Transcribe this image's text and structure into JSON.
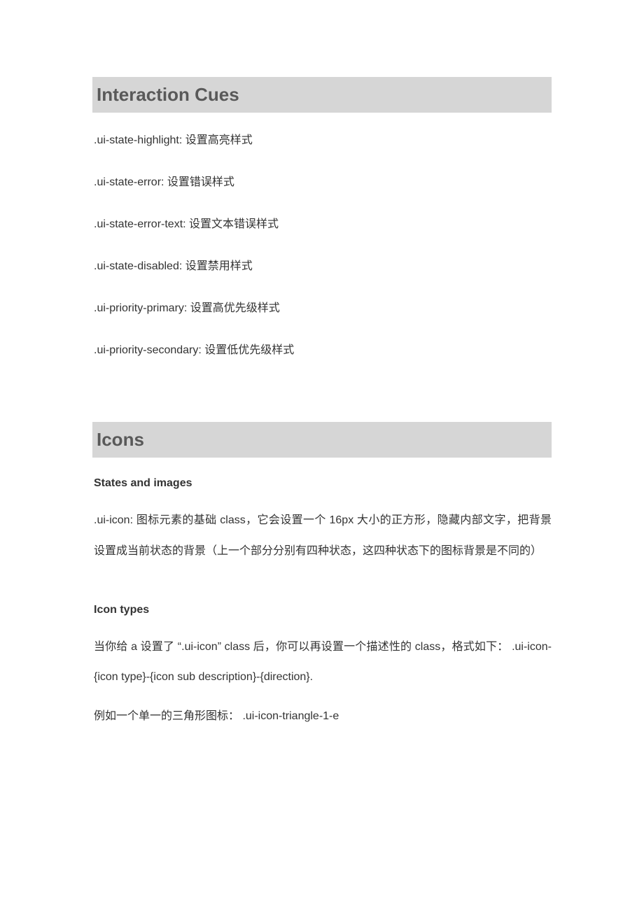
{
  "sections": {
    "interaction_cues": {
      "title": "Interaction Cues",
      "items": [
        ".ui-state-highlight:  设置高亮样式",
        ".ui-state-error:  设置错误样式",
        ".ui-state-error-text:  设置文本错误样式",
        ".ui-state-disabled:  设置禁用样式",
        ".ui-priority-primary:  设置高优先级样式",
        ".ui-priority-secondary:  设置低优先级样式"
      ]
    },
    "icons": {
      "title": "Icons",
      "states_heading": "States and images",
      "states_paragraph": ".ui-icon:  图标元素的基础  class，它会设置一个  16px  大小的正方形，隐藏内部文字，把背景设置成当前状态的背景（上一个部分分别有四种状态，这四种状态下的图标背景是不同的）",
      "types_heading": "Icon types",
      "types_paragraph": "当你给  a  设置了   “.ui-icon”   class  后，你可以再设置一个描述性的  class，格式如下：   .ui-icon-{icon type}-{icon sub description}-{direction}.",
      "types_example": "例如一个单一的三角形图标：   .ui-icon-triangle-1-e"
    }
  }
}
